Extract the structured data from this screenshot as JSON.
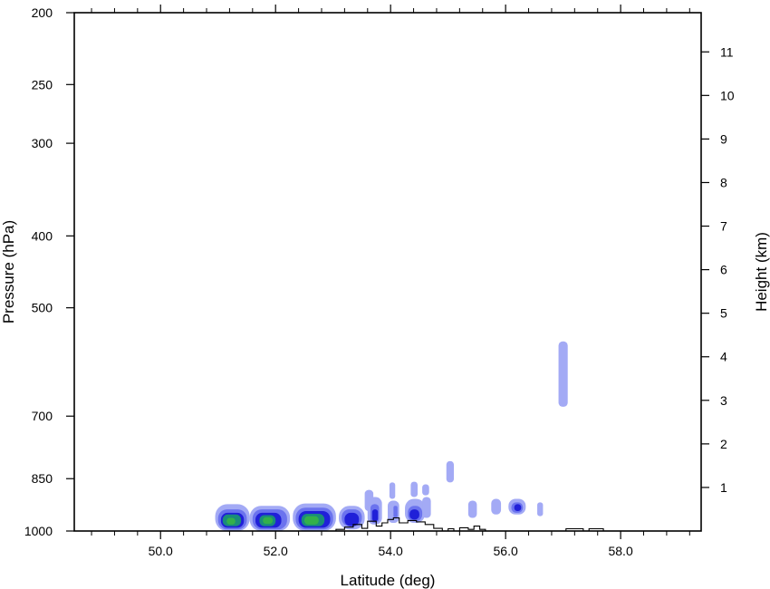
{
  "chart_data": {
    "type": "heatmap",
    "title": "",
    "xlabel": "Latitude (deg)",
    "ylabel": "Pressure (hPa)",
    "y2label": "Height (km)",
    "xlim": [
      48.5,
      59.4
    ],
    "ylim": [
      1000,
      200
    ],
    "y2lim": [
      0.0,
      11.9
    ],
    "y_scale": "log",
    "x_ticks": [
      {
        "value": 50,
        "label": "50.0"
      },
      {
        "value": 52,
        "label": "52.0"
      },
      {
        "value": 54,
        "label": "54.0"
      },
      {
        "value": 56,
        "label": "56.0"
      },
      {
        "value": 58,
        "label": "58.0"
      }
    ],
    "x_minor_step": 0.4,
    "y_ticks": [
      {
        "value": 200,
        "label": "200"
      },
      {
        "value": 250,
        "label": "250"
      },
      {
        "value": 300,
        "label": "300"
      },
      {
        "value": 400,
        "label": "400"
      },
      {
        "value": 500,
        "label": "500"
      },
      {
        "value": 700,
        "label": "700"
      },
      {
        "value": 850,
        "label": "850"
      },
      {
        "value": 1000,
        "label": "1000"
      }
    ],
    "y2_ticks": [
      {
        "value": 1,
        "label": "1"
      },
      {
        "value": 2,
        "label": "2"
      },
      {
        "value": 3,
        "label": "3"
      },
      {
        "value": 4,
        "label": "4"
      },
      {
        "value": 5,
        "label": "5"
      },
      {
        "value": 6,
        "label": "6"
      },
      {
        "value": 7,
        "label": "7"
      },
      {
        "value": 8,
        "label": "8"
      },
      {
        "value": 9,
        "label": "9"
      },
      {
        "value": 10,
        "label": "10"
      },
      {
        "value": 11,
        "label": "11"
      }
    ],
    "grid": false,
    "legend": "none",
    "colors": {
      "level1": "#a3aaf5",
      "level2": "#6b73ee",
      "level3": "#2020d8",
      "level4": "#1a8c7a",
      "level5": "#34b04a",
      "terrain_line": "#000000"
    },
    "regions": [
      {
        "level": 1,
        "lat": [
          50.95,
          51.55
        ],
        "p": [
          1000,
          920
        ]
      },
      {
        "level": 1,
        "lat": [
          51.55,
          52.25
        ],
        "p": [
          1000,
          925
        ]
      },
      {
        "level": 1,
        "lat": [
          52.3,
          53.05
        ],
        "p": [
          1000,
          918
        ]
      },
      {
        "level": 1,
        "lat": [
          53.1,
          53.55
        ],
        "p": [
          995,
          925
        ]
      },
      {
        "level": 1,
        "lat": [
          53.6,
          53.85
        ],
        "p": [
          980,
          900
        ]
      },
      {
        "level": 1,
        "lat": [
          53.55,
          53.7
        ],
        "p": [
          940,
          880
        ]
      },
      {
        "level": 1,
        "lat": [
          53.95,
          54.15
        ],
        "p": [
          975,
          910
        ]
      },
      {
        "level": 1,
        "lat": [
          54.25,
          54.6
        ],
        "p": [
          975,
          905
        ]
      },
      {
        "level": 1,
        "lat": [
          54.55,
          54.7
        ],
        "p": [
          960,
          900
        ]
      },
      {
        "level": 1,
        "lat": [
          53.98,
          54.08
        ],
        "p": [
          905,
          860
        ]
      },
      {
        "level": 1,
        "lat": [
          54.35,
          54.47
        ],
        "p": [
          900,
          858
        ]
      },
      {
        "level": 1,
        "lat": [
          54.55,
          54.67
        ],
        "p": [
          895,
          865
        ]
      },
      {
        "level": 1,
        "lat": [
          54.97,
          55.1
        ],
        "p": [
          860,
          805
        ]
      },
      {
        "level": 1,
        "lat": [
          55.35,
          55.5
        ],
        "p": [
          960,
          910
        ]
      },
      {
        "level": 1,
        "lat": [
          55.75,
          55.92
        ],
        "p": [
          950,
          905
        ]
      },
      {
        "level": 1,
        "lat": [
          56.05,
          56.35
        ],
        "p": [
          950,
          905
        ]
      },
      {
        "level": 1,
        "lat": [
          56.55,
          56.65
        ],
        "p": [
          955,
          915
        ]
      },
      {
        "level": 1,
        "lat": [
          56.92,
          57.08
        ],
        "p": [
          680,
          555
        ]
      },
      {
        "level": 2,
        "lat": [
          51.0,
          51.5
        ],
        "p": [
          995,
          935
        ]
      },
      {
        "level": 2,
        "lat": [
          51.6,
          52.2
        ],
        "p": [
          995,
          935
        ]
      },
      {
        "level": 2,
        "lat": [
          52.35,
          53.0
        ],
        "p": [
          995,
          930
        ]
      },
      {
        "level": 2,
        "lat": [
          53.15,
          53.5
        ],
        "p": [
          985,
          935
        ]
      },
      {
        "level": 2,
        "lat": [
          53.65,
          53.8
        ],
        "p": [
          975,
          920
        ]
      },
      {
        "level": 2,
        "lat": [
          54.05,
          54.12
        ],
        "p": [
          960,
          925
        ]
      },
      {
        "level": 2,
        "lat": [
          54.3,
          54.55
        ],
        "p": [
          970,
          925
        ]
      },
      {
        "level": 2,
        "lat": [
          56.1,
          56.3
        ],
        "p": [
          945,
          915
        ]
      },
      {
        "level": 3,
        "lat": [
          51.05,
          51.45
        ],
        "p": [
          990,
          945
        ]
      },
      {
        "level": 3,
        "lat": [
          51.65,
          52.1
        ],
        "p": [
          990,
          945
        ]
      },
      {
        "level": 3,
        "lat": [
          52.4,
          52.95
        ],
        "p": [
          990,
          940
        ]
      },
      {
        "level": 3,
        "lat": [
          53.2,
          53.45
        ],
        "p": [
          985,
          945
        ]
      },
      {
        "level": 3,
        "lat": [
          53.68,
          53.78
        ],
        "p": [
          970,
          935
        ]
      },
      {
        "level": 3,
        "lat": [
          54.33,
          54.5
        ],
        "p": [
          965,
          935
        ]
      },
      {
        "level": 3,
        "lat": [
          56.15,
          56.27
        ],
        "p": [
          940,
          920
        ]
      },
      {
        "level": 4,
        "lat": [
          51.08,
          51.4
        ],
        "p": [
          985,
          950
        ]
      },
      {
        "level": 4,
        "lat": [
          51.72,
          52.0
        ],
        "p": [
          985,
          952
        ]
      },
      {
        "level": 4,
        "lat": [
          52.45,
          52.85
        ],
        "p": [
          985,
          948
        ]
      },
      {
        "level": 5,
        "lat": [
          51.15,
          51.3
        ],
        "p": [
          980,
          960
        ]
      },
      {
        "level": 5,
        "lat": [
          51.78,
          51.95
        ],
        "p": [
          978,
          958
        ]
      },
      {
        "level": 5,
        "lat": [
          52.5,
          52.75
        ],
        "p": [
          980,
          955
        ]
      }
    ],
    "terrain": [
      [
        53.05,
        1000
      ],
      [
        53.05,
        995
      ],
      [
        53.2,
        995
      ],
      [
        53.2,
        988
      ],
      [
        53.35,
        988
      ],
      [
        53.35,
        980
      ],
      [
        53.5,
        980
      ],
      [
        53.5,
        992
      ],
      [
        53.6,
        992
      ],
      [
        53.6,
        970
      ],
      [
        53.75,
        970
      ],
      [
        53.75,
        985
      ],
      [
        53.85,
        985
      ],
      [
        53.85,
        975
      ],
      [
        53.95,
        975
      ],
      [
        53.95,
        965
      ],
      [
        54.05,
        965
      ],
      [
        54.05,
        960
      ],
      [
        54.15,
        960
      ],
      [
        54.15,
        975
      ],
      [
        54.3,
        975
      ],
      [
        54.3,
        968
      ],
      [
        54.45,
        968
      ],
      [
        54.45,
        972
      ],
      [
        54.6,
        972
      ],
      [
        54.6,
        980
      ],
      [
        54.75,
        980
      ],
      [
        54.75,
        992
      ],
      [
        54.9,
        992
      ],
      [
        54.9,
        1000
      ],
      [
        55.0,
        1000
      ],
      [
        55.0,
        993
      ],
      [
        55.1,
        993
      ],
      [
        55.1,
        1000
      ],
      [
        55.2,
        1000
      ],
      [
        55.2,
        990
      ],
      [
        55.35,
        990
      ],
      [
        55.35,
        995
      ],
      [
        55.45,
        995
      ],
      [
        55.45,
        985
      ],
      [
        55.55,
        985
      ],
      [
        55.55,
        995
      ],
      [
        55.65,
        995
      ],
      [
        55.65,
        1000
      ]
    ],
    "terrain_bumps": [
      {
        "lat": [
          57.05,
          57.35
        ],
        "p": 993
      },
      {
        "lat": [
          57.45,
          57.7
        ],
        "p": 993
      }
    ]
  }
}
